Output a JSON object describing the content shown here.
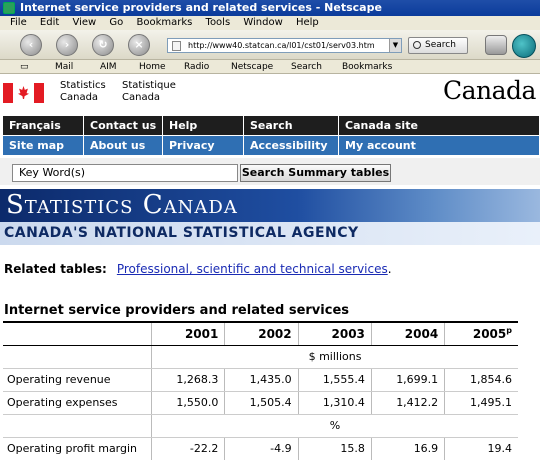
{
  "window": {
    "title": "Internet service providers and related services - Netscape"
  },
  "menu": [
    "File",
    "Edit",
    "View",
    "Go",
    "Bookmarks",
    "Tools",
    "Window",
    "Help"
  ],
  "navigation": {
    "url": "http://www40.statcan.ca/l01/cst01/serv03.htm",
    "search_label": "Search"
  },
  "personal_toolbar": [
    "Mail",
    "AIM",
    "Home",
    "Radio",
    "Netscape",
    "Search",
    "Bookmarks"
  ],
  "header": {
    "en": "Statistics\nCanada",
    "fr": "Statistique\nCanada",
    "wordmark": "Canada"
  },
  "nav_rows": [
    [
      "Français",
      "Contact us",
      "Help",
      "Search",
      "Canada site"
    ],
    [
      "Site map",
      "About us",
      "Privacy",
      "Accessibility",
      "My account"
    ]
  ],
  "search": {
    "keyword": "Key Word(s)",
    "button": "Search Summary tables"
  },
  "banner": {
    "title": "Statistics Canada",
    "subtitle": "CANADA'S NATIONAL STATISTICAL AGENCY"
  },
  "related": {
    "label": "Related tables:",
    "link": "Professional, scientific and technical services",
    "suffix": "."
  },
  "table": {
    "title": "Internet service providers and related services",
    "years": [
      "2001",
      "2002",
      "2003",
      "2004",
      "2005"
    ],
    "last_year_note": "p",
    "unit_millions": "$ millions",
    "unit_percent": "%",
    "rows": [
      {
        "label": "Operating revenue",
        "values": [
          "1,268.3",
          "1,435.0",
          "1,555.4",
          "1,699.1",
          "1,854.6"
        ]
      },
      {
        "label": "Operating expenses",
        "values": [
          "1,550.0",
          "1,505.4",
          "1,310.4",
          "1,412.2",
          "1,495.1"
        ]
      },
      {
        "label": "Operating profit margin",
        "values": [
          "-22.2",
          "-4.9",
          "15.8",
          "16.9",
          "19.4"
        ]
      }
    ]
  }
}
